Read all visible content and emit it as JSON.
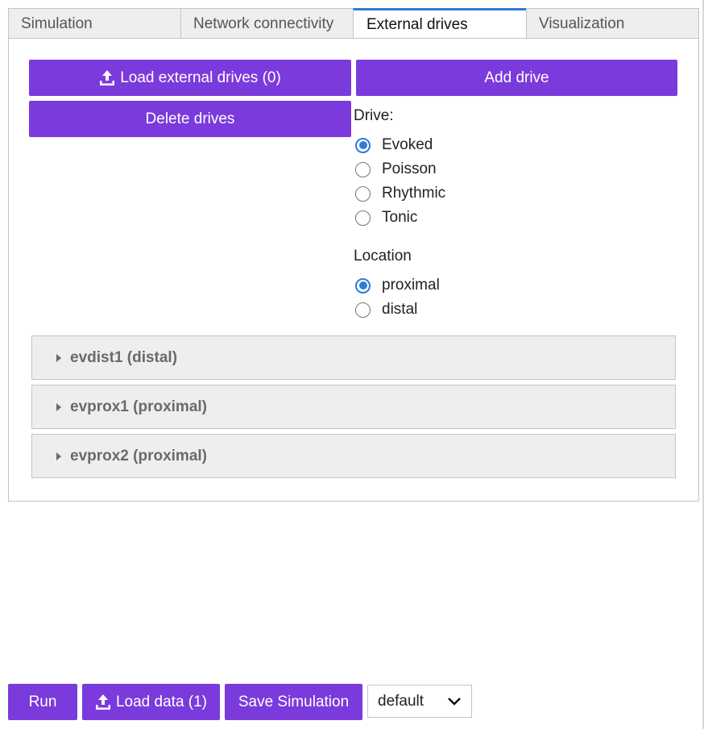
{
  "tabs": [
    {
      "label": "Simulation",
      "active": false
    },
    {
      "label": "Network connectivity",
      "active": false
    },
    {
      "label": "External drives",
      "active": true
    },
    {
      "label": "Visualization",
      "active": false
    }
  ],
  "drives_panel": {
    "load_button_label": "Load external drives (0)",
    "add_button_label": "Add drive",
    "delete_button_label": "Delete drives",
    "drive_type_label": "Drive:",
    "drive_types": [
      {
        "label": "Evoked",
        "checked": true
      },
      {
        "label": "Poisson",
        "checked": false
      },
      {
        "label": "Rhythmic",
        "checked": false
      },
      {
        "label": "Tonic",
        "checked": false
      }
    ],
    "location_label": "Location",
    "locations": [
      {
        "label": "proximal",
        "checked": true
      },
      {
        "label": "distal",
        "checked": false
      }
    ],
    "drives": [
      {
        "label": "evdist1 (distal)"
      },
      {
        "label": "evprox1 (proximal)"
      },
      {
        "label": "evprox2 (proximal)"
      }
    ]
  },
  "footer": {
    "run_label": "Run",
    "load_data_label": "Load data (1)",
    "save_label": "Save Simulation",
    "select_value": "default"
  },
  "colors": {
    "button": "#7b3adc",
    "accent": "#2f7bd9",
    "tab_bg": "#eeeeee",
    "border": "#c4c4c4"
  },
  "icons": {
    "upload": "upload-icon",
    "caret": "caret-right-icon",
    "chevron": "chevron-down-icon"
  }
}
